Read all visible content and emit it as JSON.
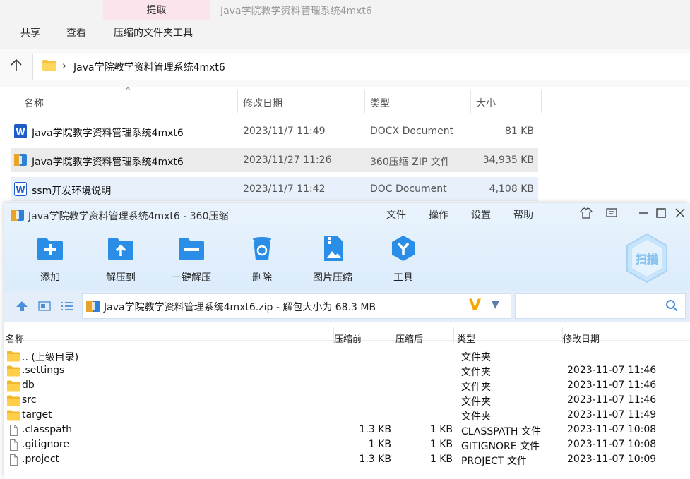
{
  "explorer": {
    "ribbon": {
      "extract_tab": "提取",
      "title": "Java学院教学资料管理系统4mxt6",
      "tabs": [
        "共享",
        "查看",
        "压缩的文件夹工具"
      ]
    },
    "address": {
      "chevron": "›",
      "path": "Java学院教学资料管理系统4mxt6"
    },
    "columns": {
      "name": "名称",
      "date": "修改日期",
      "type": "类型",
      "size": "大小"
    },
    "files": [
      {
        "icon": "word-docx-icon",
        "name": "Java学院教学资料管理系统4mxt6",
        "date": "2023/11/7 11:49",
        "type": "DOCX Document",
        "size": "81 KB"
      },
      {
        "icon": "zip-archive-icon",
        "name": "Java学院教学资料管理系统4mxt6",
        "date": "2023/11/27 11:26",
        "type": "360压缩 ZIP 文件",
        "size": "34,935 KB"
      },
      {
        "icon": "word-doc-icon",
        "name": "ssm开发环境说明",
        "date": "2023/11/7 11:42",
        "type": "DOC Document",
        "size": "4,108 KB"
      }
    ]
  },
  "zip": {
    "title": "Java学院教学资料管理系统4mxt6 - 360压缩",
    "menu": [
      "文件",
      "操作",
      "设置",
      "帮助"
    ],
    "tools": [
      "添加",
      "解压到",
      "一键解压",
      "删除",
      "图片压缩",
      "工具"
    ],
    "scan_label": "扫描",
    "path_text": "Java学院教学资料管理系统4mxt6.zip - 解包大小为 68.3 MB",
    "columns": {
      "name": "名称",
      "before": "压缩前",
      "after": "压缩后",
      "type": "类型",
      "date": "修改日期"
    },
    "rows": [
      {
        "icon": "folder-icon",
        "name": ".. (上级目录)",
        "before": "",
        "after": "",
        "type": "文件夹",
        "date": ""
      },
      {
        "icon": "folder-icon",
        "name": ".settings",
        "before": "",
        "after": "",
        "type": "文件夹",
        "date": "2023-11-07 11:46"
      },
      {
        "icon": "folder-icon",
        "name": "db",
        "before": "",
        "after": "",
        "type": "文件夹",
        "date": "2023-11-07 11:46"
      },
      {
        "icon": "folder-icon",
        "name": "src",
        "before": "",
        "after": "",
        "type": "文件夹",
        "date": "2023-11-07 11:46"
      },
      {
        "icon": "folder-icon",
        "name": "target",
        "before": "",
        "after": "",
        "type": "文件夹",
        "date": "2023-11-07 11:49"
      },
      {
        "icon": "file-icon",
        "name": ".classpath",
        "before": "1.3 KB",
        "after": "1 KB",
        "type": "CLASSPATH 文件",
        "date": "2023-11-07 10:08"
      },
      {
        "icon": "file-icon",
        "name": ".gitignore",
        "before": "1 KB",
        "after": "1 KB",
        "type": "GITIGNORE 文件",
        "date": "2023-11-07 10:08"
      },
      {
        "icon": "file-icon",
        "name": ".project",
        "before": "1.3 KB",
        "after": "1 KB",
        "type": "PROJECT 文件",
        "date": "2023-11-07 10:09"
      }
    ]
  },
  "colors": {
    "accent": "#1a7fd6",
    "selection": "#ebebeb",
    "extract_tab": "#fce4ec",
    "zip_header": "#e3eefa"
  }
}
